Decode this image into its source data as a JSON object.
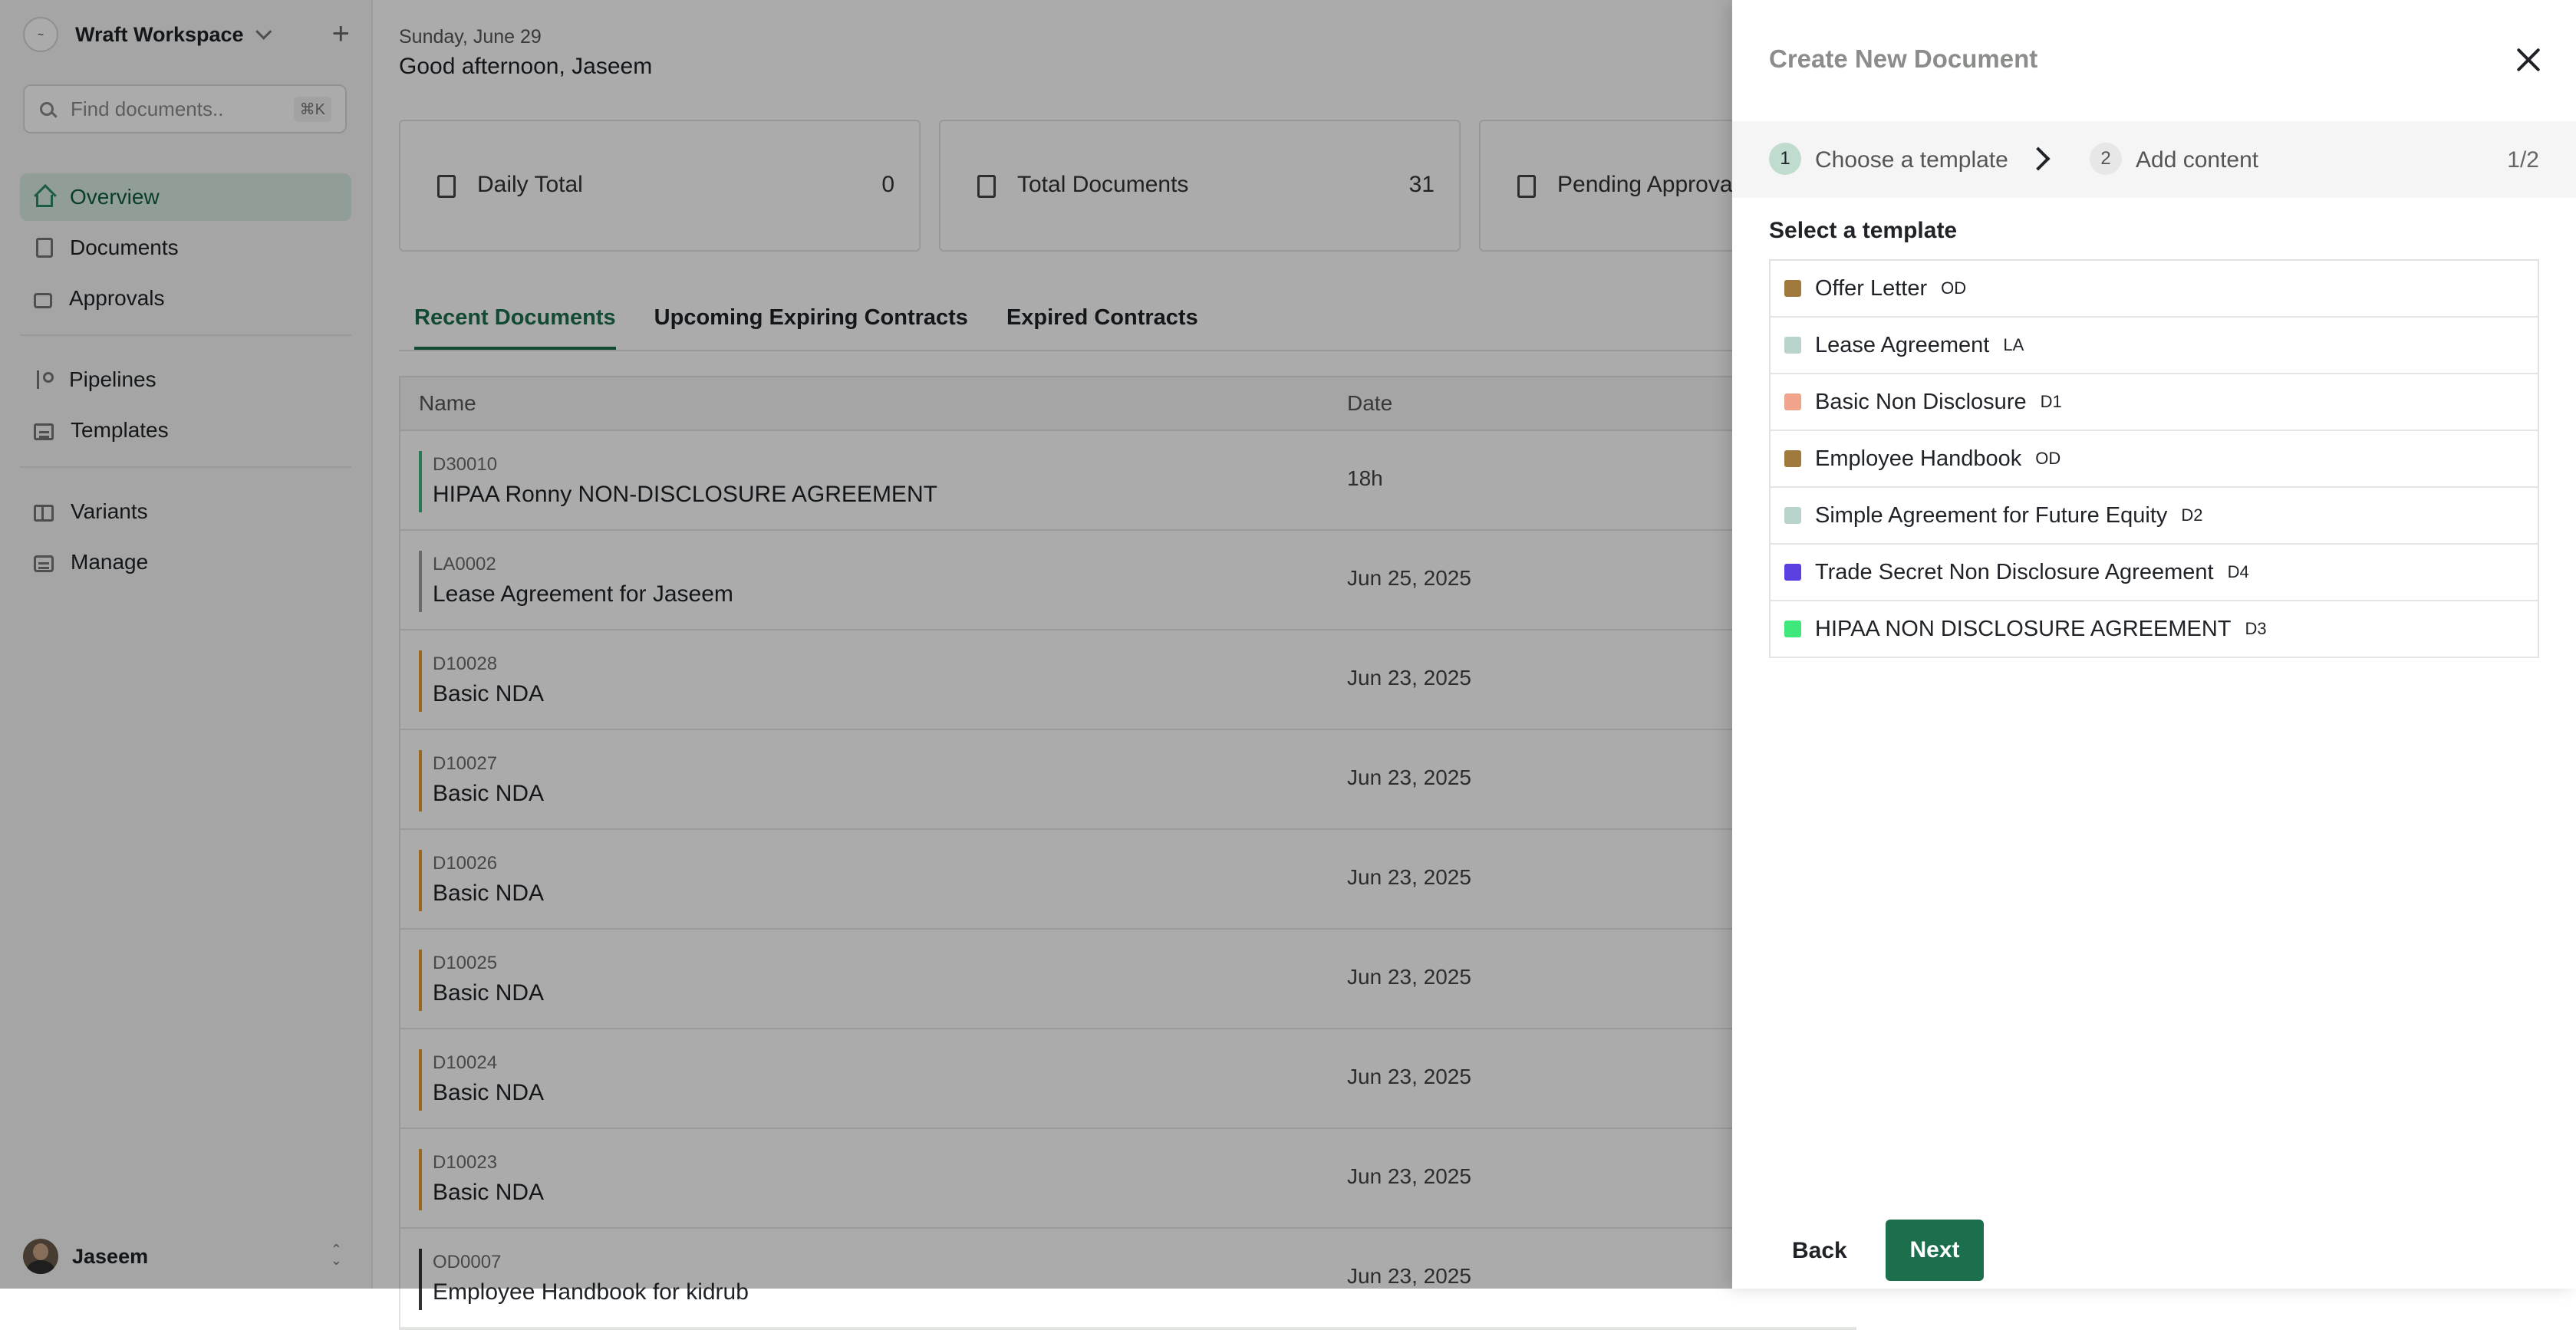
{
  "sidebar": {
    "workspace_name": "Wraft Workspace",
    "search_placeholder": "Find documents..",
    "search_shortcut": "⌘K",
    "nav_primary": [
      {
        "label": "Overview",
        "icon": "home-icon",
        "active": true
      },
      {
        "label": "Documents",
        "icon": "document-icon",
        "active": false
      },
      {
        "label": "Approvals",
        "icon": "thumbs-up-icon",
        "active": false
      }
    ],
    "nav_secondary": [
      {
        "label": "Pipelines",
        "icon": "branch-icon"
      },
      {
        "label": "Templates",
        "icon": "template-icon"
      }
    ],
    "nav_tertiary": [
      {
        "label": "Variants",
        "icon": "variants-icon"
      },
      {
        "label": "Manage",
        "icon": "manage-icon"
      }
    ],
    "user_name": "Jaseem"
  },
  "main": {
    "date": "Sunday, June 29",
    "greeting": "Good afternoon, Jaseem",
    "stats": [
      {
        "label": "Daily Total",
        "value": "0"
      },
      {
        "label": "Total Documents",
        "value": "31"
      },
      {
        "label": "Pending Approva",
        "value": ""
      }
    ],
    "tabs": [
      "Recent Documents",
      "Upcoming Expiring Contracts",
      "Expired Contracts"
    ],
    "table_headers": {
      "name": "Name",
      "date": "Date"
    },
    "rows": [
      {
        "code": "D30010",
        "title": "HIPAA Ronny NON-DISCLOSURE AGREEMENT",
        "date": "18h",
        "color": "#3fb57d"
      },
      {
        "code": "LA0002",
        "title": "Lease Agreement for Jaseem",
        "date": "Jun 25, 2025",
        "color": "#9aa0a0"
      },
      {
        "code": "D10028",
        "title": "Basic NDA",
        "date": "Jun 23, 2025",
        "color": "#e89a2c"
      },
      {
        "code": "D10027",
        "title": "Basic NDA",
        "date": "Jun 23, 2025",
        "color": "#e89a2c"
      },
      {
        "code": "D10026",
        "title": "Basic NDA",
        "date": "Jun 23, 2025",
        "color": "#e89a2c"
      },
      {
        "code": "D10025",
        "title": "Basic NDA",
        "date": "Jun 23, 2025",
        "color": "#e89a2c"
      },
      {
        "code": "D10024",
        "title": "Basic NDA",
        "date": "Jun 23, 2025",
        "color": "#e89a2c"
      },
      {
        "code": "D10023",
        "title": "Basic NDA",
        "date": "Jun 23, 2025",
        "color": "#e89a2c"
      },
      {
        "code": "OD0007",
        "title": "Employee Handbook for kidrub",
        "date": "Jun 23, 2025",
        "color": "#333333"
      }
    ]
  },
  "drawer": {
    "title": "Create New Document",
    "steps": [
      {
        "num": "1",
        "label": "Choose a template"
      },
      {
        "num": "2",
        "label": "Add content"
      }
    ],
    "step_count": "1/2",
    "select_label": "Select a template",
    "templates": [
      {
        "name": "Offer Letter",
        "badge": "OD",
        "color": "#a07a3c"
      },
      {
        "name": "Lease Agreement",
        "badge": "LA",
        "color": "#b9d4cc"
      },
      {
        "name": "Basic Non Disclosure",
        "badge": "D1",
        "color": "#f0a48c"
      },
      {
        "name": "Employee Handbook",
        "badge": "OD",
        "color": "#a07a3c"
      },
      {
        "name": "Simple Agreement for Future Equity",
        "badge": "D2",
        "color": "#b9d4cc"
      },
      {
        "name": "Trade Secret Non Disclosure Agreement",
        "badge": "D4",
        "color": "#5b3fe0"
      },
      {
        "name": "HIPAA NON DISCLOSURE AGREEMENT",
        "badge": "D3",
        "color": "#3ee87a"
      }
    ],
    "back_label": "Back",
    "next_label": "Next"
  }
}
